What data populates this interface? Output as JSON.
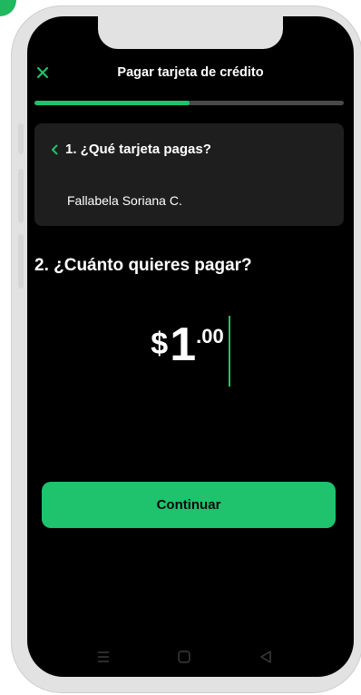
{
  "header": {
    "title": "Pagar tarjeta de crédito",
    "close_icon": "close-icon"
  },
  "progress": {
    "fraction": 0.5,
    "accent_color": "#1fc26d",
    "track_color": "#4a4a4a"
  },
  "step1": {
    "label": "1. ¿Qué tarjeta pagas?",
    "selected_card": "Fallabela Soriana C.",
    "icon": "chevron-left-icon"
  },
  "step2": {
    "label": "2. ¿Cuánto quieres pagar?"
  },
  "amount": {
    "currency": "$",
    "integer": "1",
    "decimals": ".00"
  },
  "actions": {
    "continue_label": "Continuar"
  },
  "system_nav": {
    "icons": [
      "menu-icon",
      "home-icon",
      "back-icon"
    ]
  },
  "colors": {
    "brand_green": "#1fc26d",
    "screen_bg": "#000000",
    "card_bg": "#1e1e1e"
  }
}
